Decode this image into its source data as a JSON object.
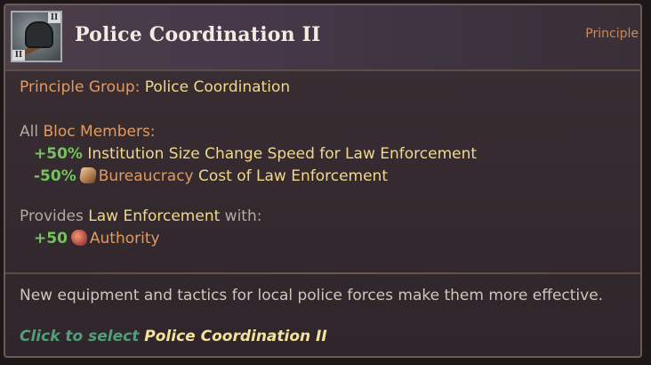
{
  "header": {
    "title": "Police Coordination II",
    "type_label": "Principle",
    "icon": "police-helmet-icon",
    "badge_top": "II",
    "badge_bottom": "II"
  },
  "principle_group": {
    "label": "Principle Group:",
    "value": "Police Coordination"
  },
  "bloc_members": {
    "prefix": "All",
    "label": "Bloc Members:",
    "effects": [
      {
        "amount": "+50%",
        "icon": "",
        "highlight": "",
        "text": "Institution Size Change Speed for Law Enforcement"
      },
      {
        "amount": "-50%",
        "icon": "bureaucracy-scroll-icon",
        "highlight": "Bureaucracy",
        "text": "Cost of Law Enforcement"
      }
    ]
  },
  "provides": {
    "prefix": "Provides",
    "institution": "Law Enforcement",
    "suffix": "with:",
    "effects": [
      {
        "amount": "+50",
        "icon": "authority-icon",
        "highlight": "Authority"
      }
    ]
  },
  "flavor_text": "New equipment and tactics for local police forces make them more effective.",
  "action": {
    "lead": "Click to select",
    "target": "Police Coordination II"
  },
  "colors": {
    "accent_orange": "#e19a62",
    "positive_green": "#74c35d",
    "highlight_gold": "#f2d88a",
    "action_teal": "#4fa07a",
    "background": "#352b30"
  }
}
